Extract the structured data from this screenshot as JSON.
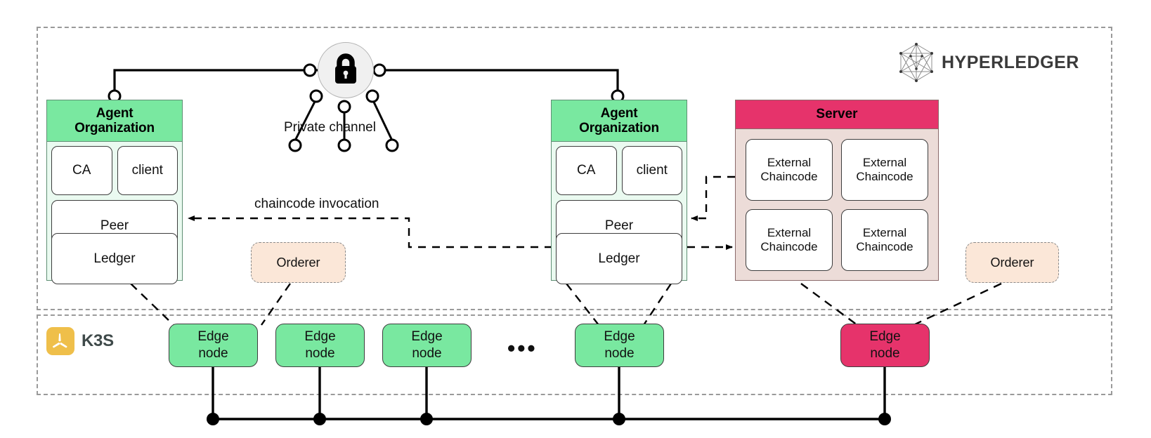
{
  "regions": {
    "hyperledger": {
      "label": "HYPERLEDGER",
      "logo_icon": "hyperledger-network-icon"
    },
    "k3s": {
      "label": "K3S",
      "logo_icon": "k3s-propeller-icon"
    }
  },
  "security": {
    "lock_icon": "padlock-icon",
    "private_channel_label": "Private channel"
  },
  "orgs": [
    {
      "title_line1": "Agent",
      "title_line2": "Organization",
      "ca": "CA",
      "client": "client",
      "peer": "Peer",
      "ledger": "Ledger"
    },
    {
      "title_line1": "Agent",
      "title_line2": "Organization",
      "ca": "CA",
      "client": "client",
      "peer": "Peer",
      "ledger": "Ledger"
    }
  ],
  "server": {
    "title": "Server",
    "chaincodes": [
      {
        "line1": "External",
        "line2": "Chaincode"
      },
      {
        "line1": "External",
        "line2": "Chaincode"
      },
      {
        "line1": "External",
        "line2": "Chaincode"
      },
      {
        "line1": "External",
        "line2": "Chaincode"
      }
    ]
  },
  "orderers": [
    {
      "label": "Orderer"
    },
    {
      "label": "Orderer"
    }
  ],
  "edge_nodes": [
    {
      "line1": "Edge",
      "line2": "node",
      "color": "#79e8a0"
    },
    {
      "line1": "Edge",
      "line2": "node",
      "color": "#79e8a0"
    },
    {
      "line1": "Edge",
      "line2": "node",
      "color": "#79e8a0"
    },
    {
      "line1": "Edge",
      "line2": "node",
      "color": "#79e8a0"
    },
    {
      "line1": "Edge",
      "line2": "node",
      "color": "#e6336b"
    }
  ],
  "ellipsis": "•••",
  "edges": {
    "chaincode_invocation_label": "chaincode invocation"
  },
  "colors": {
    "org_header": "#79e8a0",
    "org_body": "#eafaf0",
    "server_header": "#e6336b",
    "server_body": "#ecdcd8",
    "orderer_fill": "#fbe7d8",
    "edge_node": "#79e8a0",
    "edge_node_alt": "#e6336b",
    "k3s_yellow": "#efbf4a",
    "region_border": "#9a9a9a"
  }
}
